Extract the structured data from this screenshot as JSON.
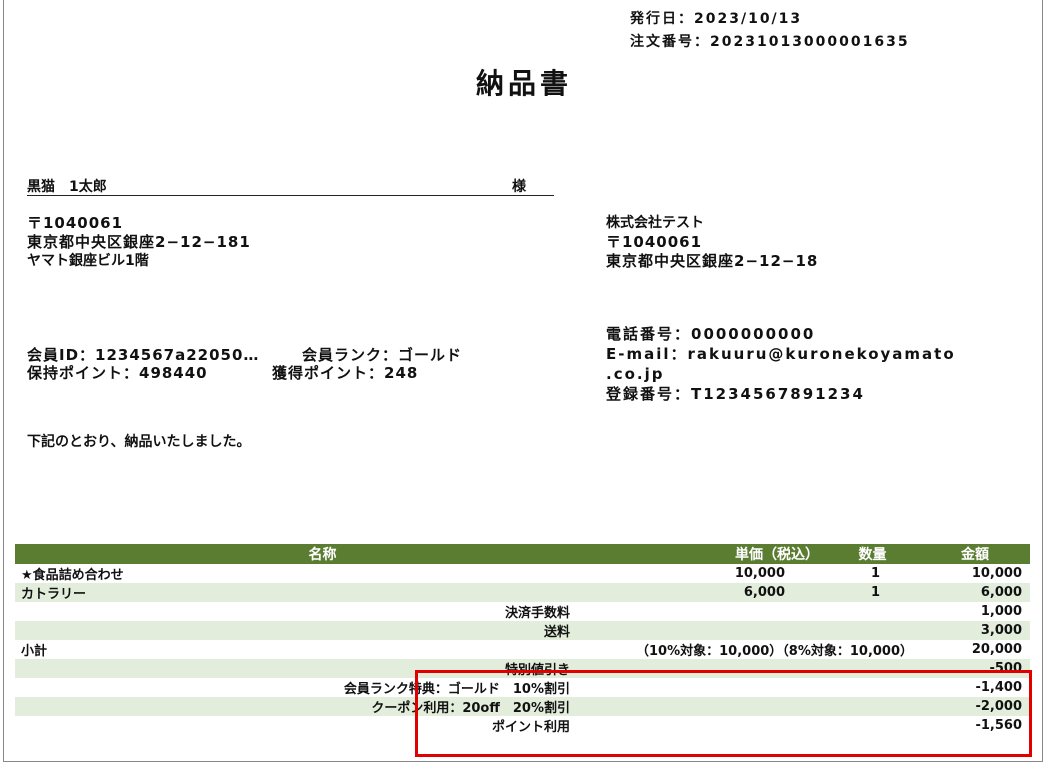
{
  "header": {
    "issue_date": "発行日：2023/10/13",
    "order_number": "注文番号：20231013000001635",
    "title": "納品書"
  },
  "customer": {
    "name": "黒猫　1太郎",
    "honorific": "様",
    "postal": "〒1040061",
    "address1": "東京都中央区銀座2−12−181",
    "address2": "ヤマト銀座ビル1階"
  },
  "company": {
    "name": "株式会社テスト",
    "postal": "〒1040061",
    "address": "東京都中央区銀座2−12−18",
    "phone": "電話番号：0000000000",
    "email_line1": "E-mail：rakuuru@kuronekoyamato",
    "email_line2": ".co.jp",
    "registration": "登録番号：T1234567891234"
  },
  "member": {
    "id": "会員ID：1234567a22050…",
    "rank": "会員ランク：ゴールド",
    "points_held": "保持ポイント：498440",
    "points_earned": "獲得ポイント：248"
  },
  "remark": "下記のとおり、納品いたしました。",
  "table": {
    "headers": {
      "name": "名称",
      "unit_price": "単価（税込）",
      "qty": "数量",
      "amount": "金額"
    },
    "rows": [
      {
        "name": "★食品詰め合わせ",
        "label": "",
        "unit_price": "10,000",
        "qty": "1",
        "amount": "10,000"
      },
      {
        "name": "カトラリー",
        "label": "",
        "unit_price": "6,000",
        "qty": "1",
        "amount": "6,000"
      },
      {
        "name": "",
        "label": "決済手数料",
        "unit_price": "",
        "qty": "",
        "amount": "1,000"
      },
      {
        "name": "",
        "label": "送料",
        "unit_price": "",
        "qty": "",
        "amount": "3,000"
      },
      {
        "name": "小計",
        "label": "",
        "unit_price": "（10%対象：10,000）（8%対象：10,000）",
        "qty": "",
        "amount": "20,000"
      },
      {
        "name": "",
        "label": "特別値引き",
        "unit_price": "",
        "qty": "",
        "amount": "-500"
      },
      {
        "name": "",
        "label": "会員ランク特典：ゴールド　10%割引",
        "unit_price": "",
        "qty": "",
        "amount": "-1,400"
      },
      {
        "name": "",
        "label": "クーポン利用：20off　20%割引",
        "unit_price": "",
        "qty": "",
        "amount": "-2,000"
      },
      {
        "name": "",
        "label": "ポイント利用",
        "unit_price": "",
        "qty": "",
        "amount": "-1,560"
      }
    ]
  }
}
